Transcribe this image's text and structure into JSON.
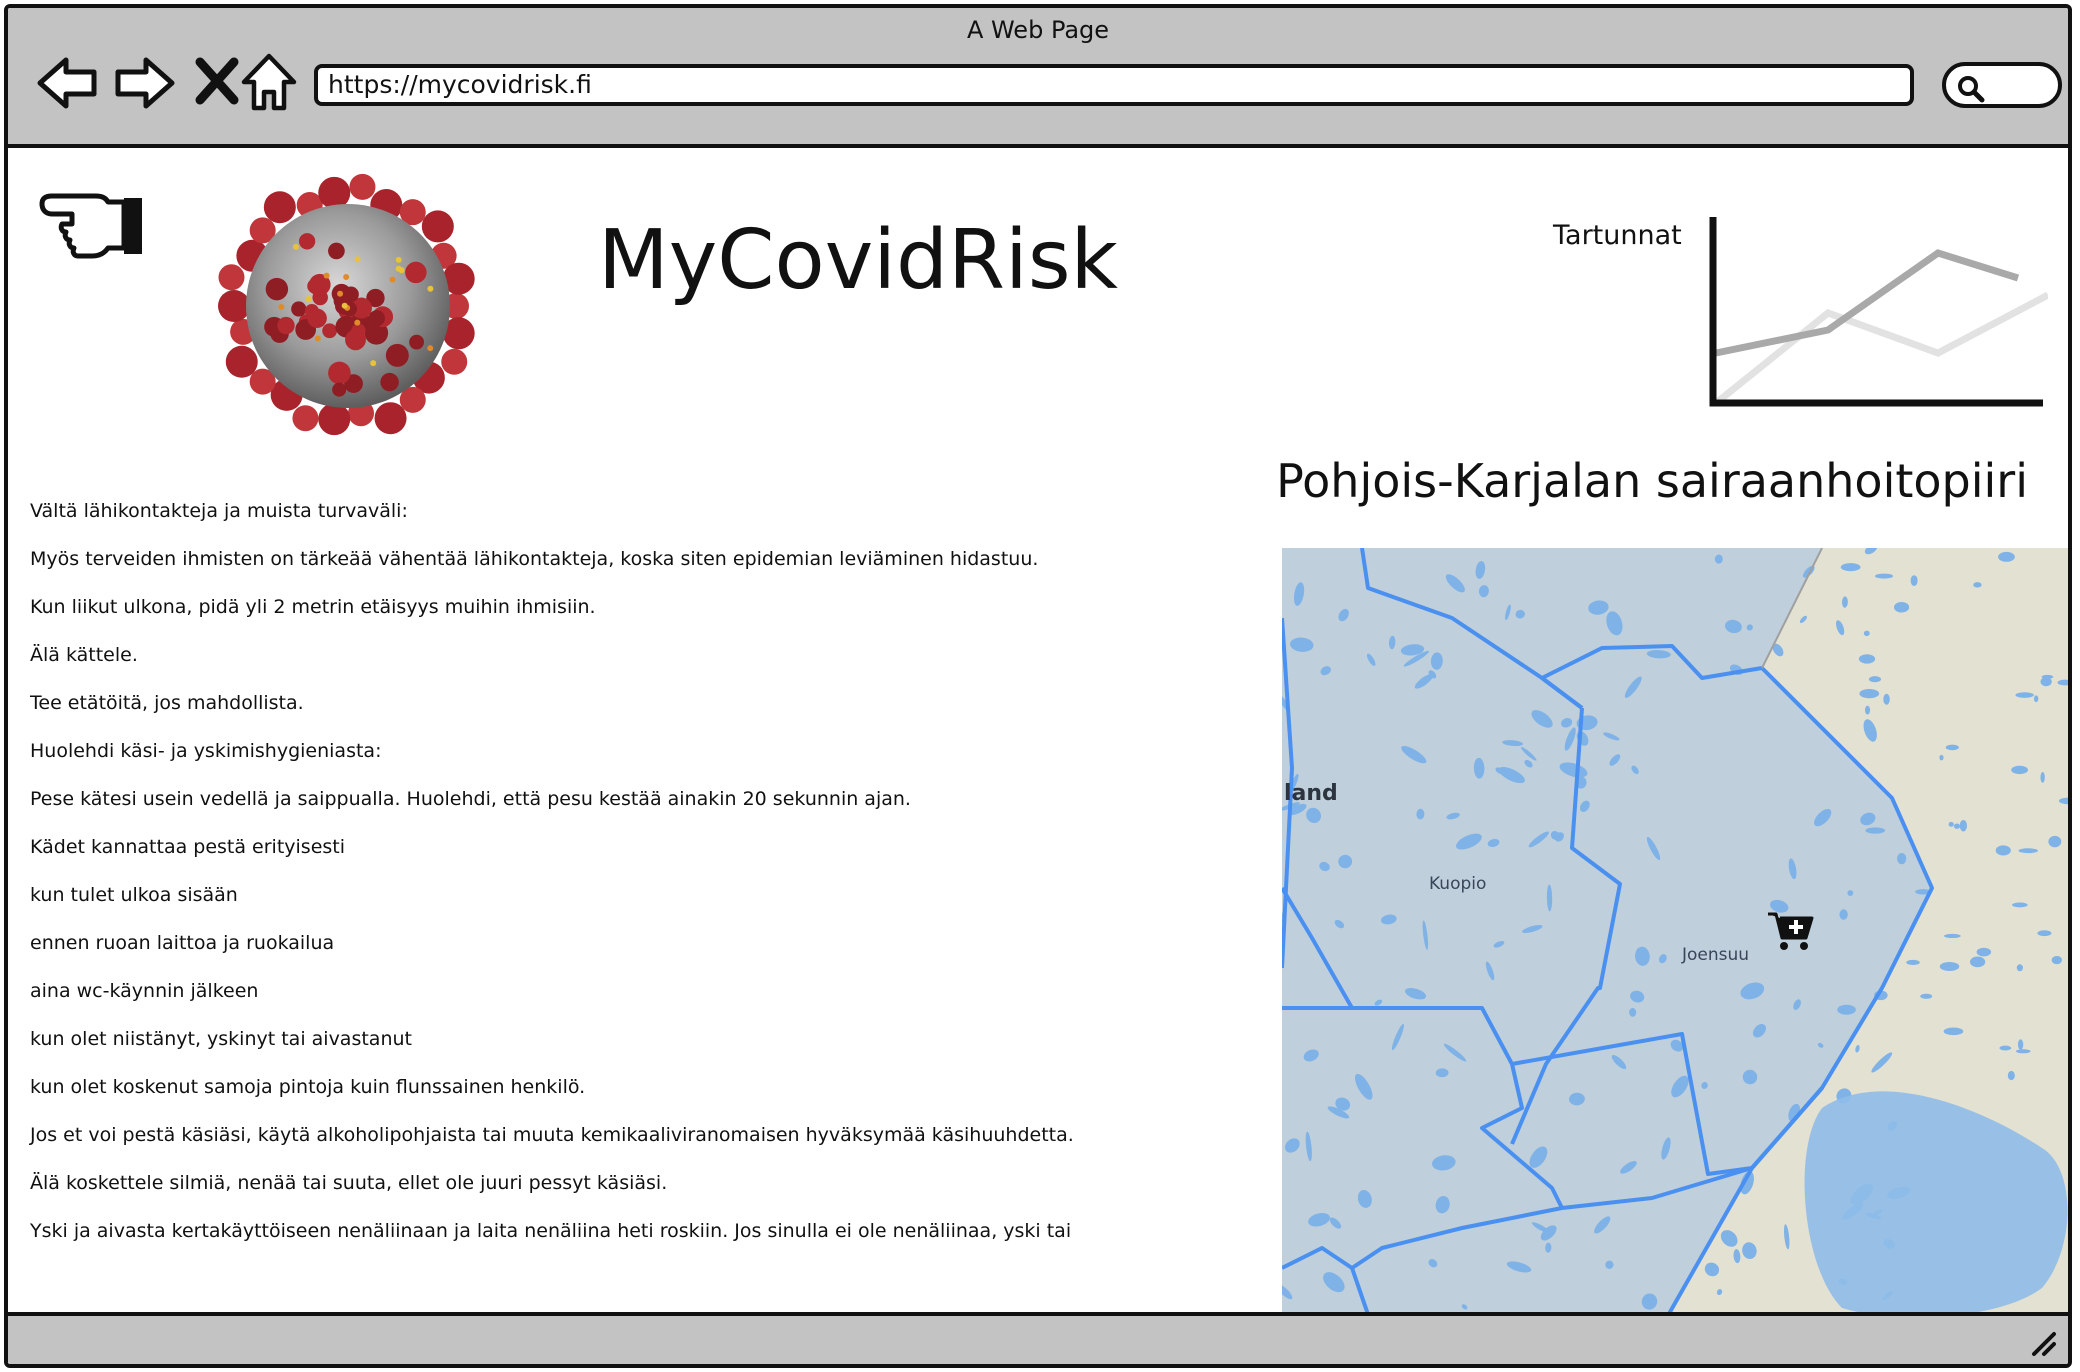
{
  "window": {
    "title": "A Web Page"
  },
  "toolbar": {
    "url": "https://mycovidrisk.fi"
  },
  "header": {
    "title": "MyCovidRisk",
    "chart_label": "Tartunnat"
  },
  "region": {
    "title": "Pohjois-Karjalan sairaanhoitopiiri"
  },
  "content": {
    "lines": [
      "Vältä lähikontakteja ja muista turvaväli:",
      "Myös terveiden ihmisten on tärkeää vähentää lähikontakteja, koska siten epidemian leviäminen hidastuu.",
      "Kun liikut ulkona, pidä yli 2 metrin etäisyys muihin ihmisiin.",
      "Älä kättele.",
      "Tee etätöitä, jos mahdollista.",
      "Huolehdi käsi- ja yskimishygieniasta:",
      "Pese kätesi usein vedellä ja saippualla. Huolehdi, että pesu kestää ainakin 20 sekunnin ajan.",
      "Kädet kannattaa pestä erityisesti",
      "kun tulet ulkoa sisään",
      "ennen ruoan laittoa ja ruokailua",
      "aina wc-käynnin jälkeen",
      "kun olet niistänyt, yskinyt tai aivastanut",
      "kun olet koskenut samoja pintoja kuin flunssainen henkilö.",
      "Jos et voi pestä käsiäsi, käytä alkoholipohjaista tai muuta kemikaaliviranomaisen hyväksymää käsihuuhdetta.",
      "Älä koskettele silmiä, nenää tai suuta, ellet ole juuri pessyt käsiäsi.",
      "Yski ja aivasta kertakäyttöiseen nenäliinaan ja laita nenäliina heti roskiin. Jos sinulla ei ole nenäliinaa, yski tai"
    ]
  },
  "map": {
    "labels": {
      "land": "land",
      "kuopio": "Kuopio",
      "joensuu": "Joensuu"
    }
  },
  "icons": {
    "back": "back-arrow-icon",
    "forward": "forward-arrow-icon",
    "stop": "close-icon",
    "home": "home-icon",
    "search": "search-icon",
    "hand": "pointing-hand-icon",
    "cart": "cart-plus-icon",
    "resize": "resize-handle-icon"
  },
  "colors": {
    "chrome": "#c3c3c3",
    "map_border": "#4a90f0",
    "map_region": "#bfcfdc",
    "map_bg": "#e3e1d2"
  }
}
